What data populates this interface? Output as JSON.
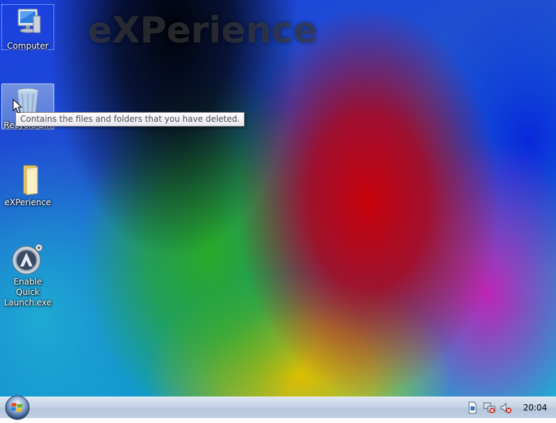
{
  "desktop": {
    "watermark": "eXPerience",
    "icons": [
      {
        "label": "Computer",
        "icon": "computer-icon"
      },
      {
        "label": "Recycle Bin",
        "icon": "recycle-bin-icon"
      },
      {
        "label": "eXPerience",
        "icon": "folder-icon"
      },
      {
        "label": "Enable Quick Launch.exe",
        "icon": "quick-launch-icon"
      }
    ],
    "tooltip": "Contains the files and folders that you have deleted."
  },
  "taskbar": {
    "start_icon": "windows-start-icon",
    "tray": [
      "document-icon",
      "network-icon",
      "volume-muted-icon"
    ],
    "clock": "20:04"
  },
  "colors": {
    "taskbar": "#c6d4e6",
    "tooltip_bg": "#ffffff",
    "selection": "#6c8fd6"
  }
}
